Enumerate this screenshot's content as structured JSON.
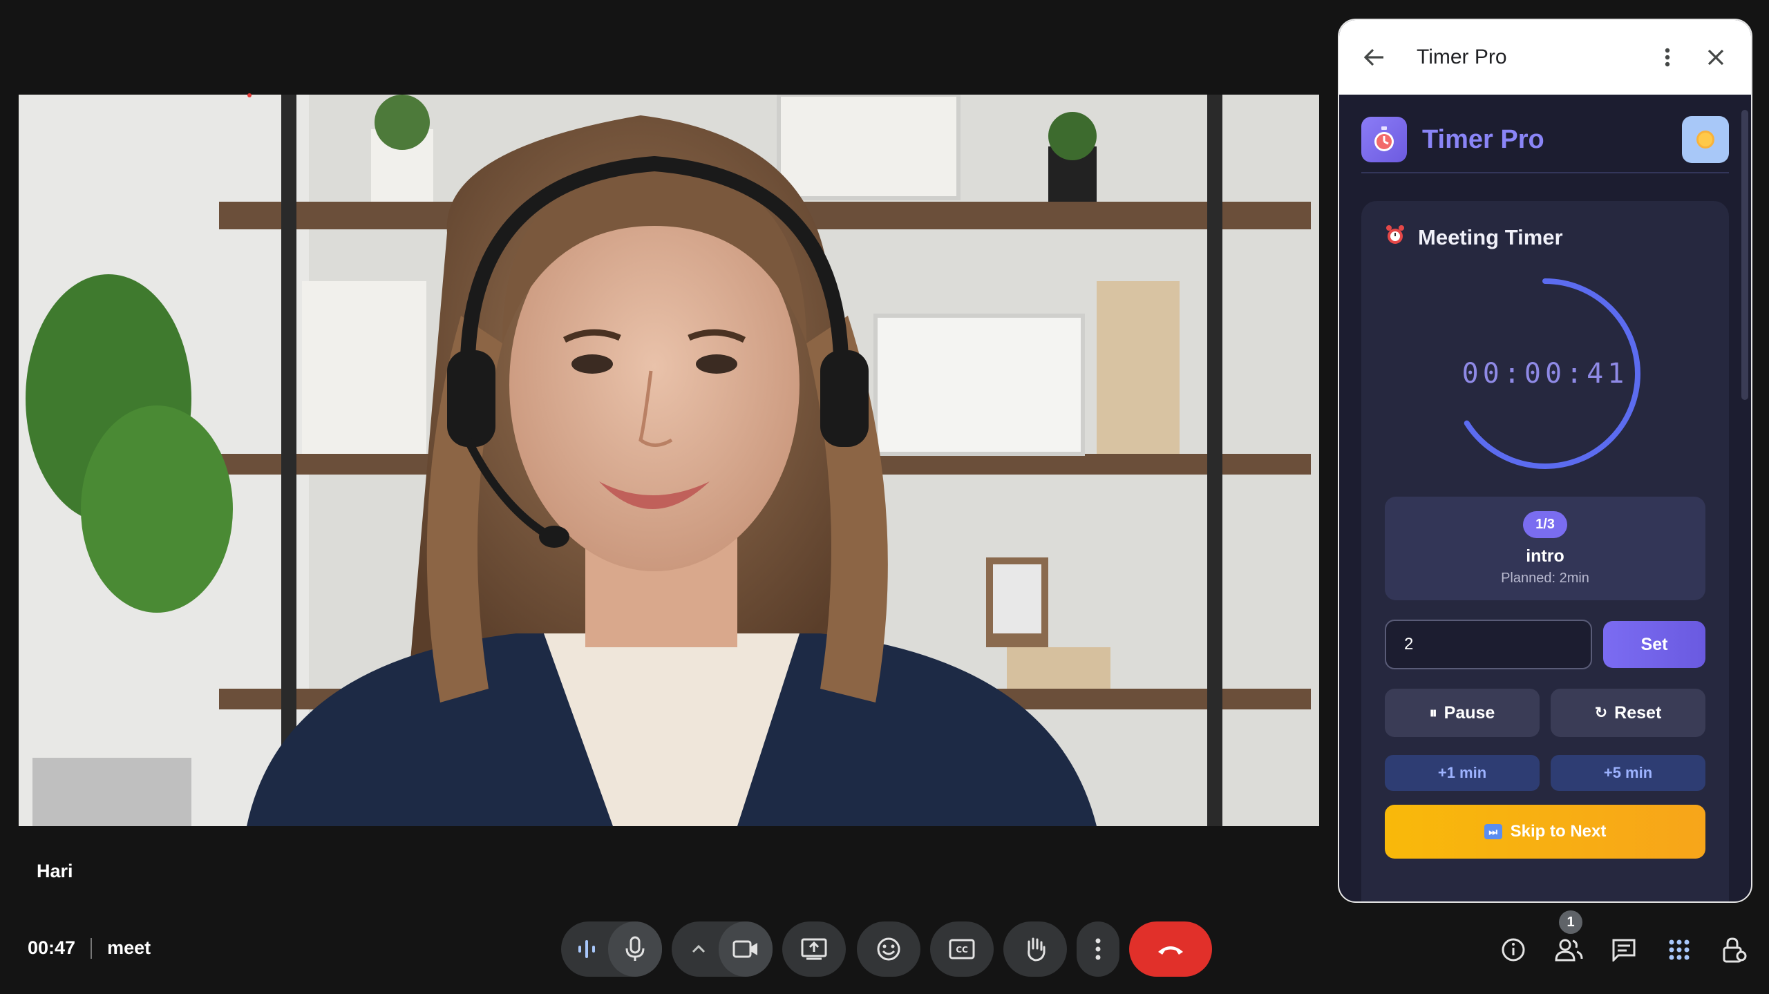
{
  "participant": {
    "name": "Hari"
  },
  "meeting": {
    "elapsed": "00:47",
    "code": "meet"
  },
  "controls": {
    "items": [
      "audio-levels-icon",
      "mic-icon",
      "chevron-up-icon",
      "camera-icon",
      "present-icon",
      "emoji-icon",
      "captions-icon",
      "raise-hand-icon",
      "more-vert-icon",
      "end-call-icon"
    ]
  },
  "right_icons": {
    "people_count": "1"
  },
  "panel": {
    "header_title": "Timer Pro",
    "app_name": "Timer Pro",
    "card_title": "Meeting Timer",
    "time": "00:00:41",
    "progress_fraction": 0.66,
    "segment": {
      "badge": "1/3",
      "name": "intro",
      "planned": "Planned: 2min"
    },
    "minutes_value": "2",
    "set_label": "Set",
    "pause_label": "Pause",
    "reset_label": "Reset",
    "plus1_label": "+1 min",
    "plus5_label": "+5 min",
    "skip_label": "Skip to Next"
  },
  "colors": {
    "accent": "#7b6cf2",
    "end_call": "#e1302a",
    "skip": "#f9b90a",
    "ring": "#5c6cf0"
  }
}
